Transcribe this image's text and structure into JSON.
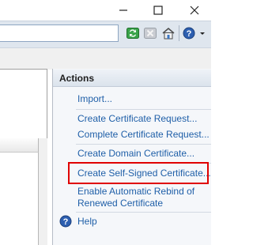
{
  "window": {
    "controls": [
      {
        "name": "minimize-icon",
        "glyph": "—"
      },
      {
        "name": "maximize-icon",
        "glyph": "☐"
      },
      {
        "name": "close-icon",
        "glyph": "✕"
      }
    ]
  },
  "toolbar": {
    "icons": [
      "refresh-icon",
      "stop-icon",
      "home-icon",
      "help-icon"
    ]
  },
  "actions": {
    "header": "Actions",
    "items": [
      {
        "label": "Import..."
      },
      {
        "label": "Create Certificate Request..."
      },
      {
        "label": "Complete Certificate Request..."
      },
      {
        "label": "Create Domain Certificate..."
      },
      {
        "label": "Create Self-Signed Certificate..."
      },
      {
        "label": "Enable Automatic Rebind of"
      },
      {
        "label": "Renewed Certificate"
      },
      {
        "label": "Help"
      }
    ]
  },
  "colors": {
    "link": "#1f5fa8",
    "highlight": "#e00000"
  }
}
